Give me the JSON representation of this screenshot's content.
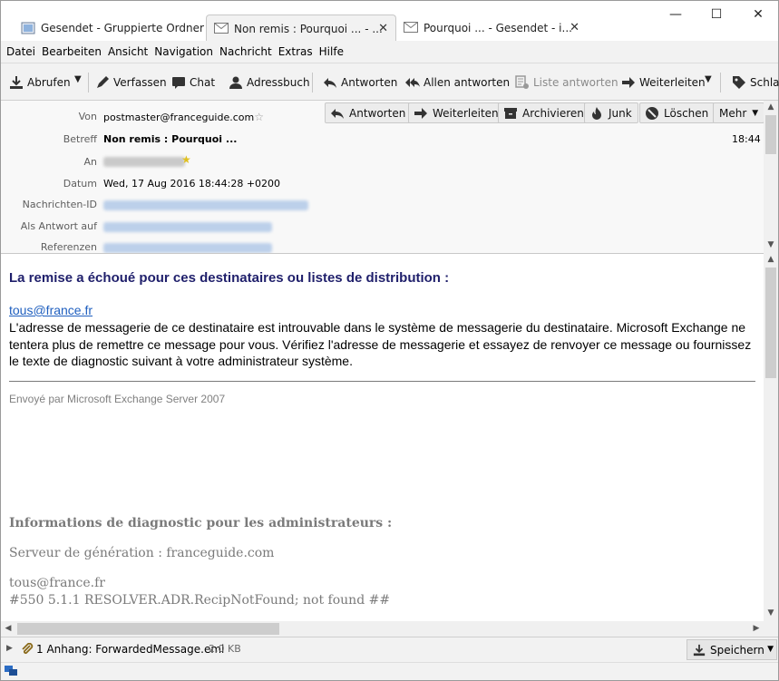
{
  "tabs": [
    {
      "label": "Gesendet - Gruppierte Ordner",
      "active": false
    },
    {
      "label": "Non remis : Pourquoi ... - ...",
      "active": true
    },
    {
      "label": "Pourquoi ... - Gesendet - i...",
      "active": false
    }
  ],
  "window": {
    "minimize": "—",
    "maximize": "☐",
    "close": "✕"
  },
  "menu": [
    "Datei",
    "Bearbeiten",
    "Ansicht",
    "Navigation",
    "Nachricht",
    "Extras",
    "Hilfe"
  ],
  "toolbar": {
    "abrufen": "Abrufen",
    "verfassen": "Verfassen",
    "chat": "Chat",
    "adressbuch": "Adressbuch",
    "antworten": "Antworten",
    "allen_antworten": "Allen antworten",
    "liste_antworten": "Liste antworten",
    "weiterleiten": "Weiterleiten",
    "schlagworte": "Schlag"
  },
  "header_buttons": {
    "antworten": "Antworten",
    "weiterleiten": "Weiterleiten",
    "archivieren": "Archivieren",
    "junk": "Junk",
    "loeschen": "Löschen",
    "mehr": "Mehr"
  },
  "header": {
    "von_label": "Von",
    "von_value": "postmaster@franceguide.com",
    "betreff_label": "Betreff",
    "betreff_value": "Non remis : Pourquoi ...",
    "time": "18:44",
    "an_label": "An",
    "datum_label": "Datum",
    "datum_value": "Wed, 17 Aug 2016 18:44:28 +0200",
    "nachrichten_id_label": "Nachrichten-ID",
    "antwort_auf_label": "Als Antwort auf",
    "referenzen_label": "Referenzen"
  },
  "body": {
    "title": "La remise a échoué pour ces destinataires ou listes de distribution :",
    "recipient_link": "tous@france.fr",
    "explanation": "L'adresse de messagerie de ce destinataire est introuvable dans le système de messagerie du destinataire. Microsoft Exchange ne tentera plus de remettre ce message pour vous. Vérifiez l'adresse de messagerie et essayez de renvoyer ce message ou fournissez le texte de diagnostic suivant à votre administrateur système.",
    "sent_by": "Envoyé par Microsoft Exchange Server 2007",
    "diag_heading": "Informations de diagnostic pour les administrateurs :",
    "generating_server": "Serveur de génération : franceguide.com",
    "diag_recipient": "tous@france.fr",
    "diag_code": "#550 5.1.1 RESOLVER.ADR.RecipNotFound; not found ##"
  },
  "attachment": {
    "summary": "1 Anhang: ForwardedMessage.eml",
    "size": "2,0 KB",
    "save_label": "Speichern"
  },
  "colors": {
    "title_blue": "#1f1f6b",
    "link": "#1f5fbf",
    "grey_text": "#7a7a7a"
  }
}
